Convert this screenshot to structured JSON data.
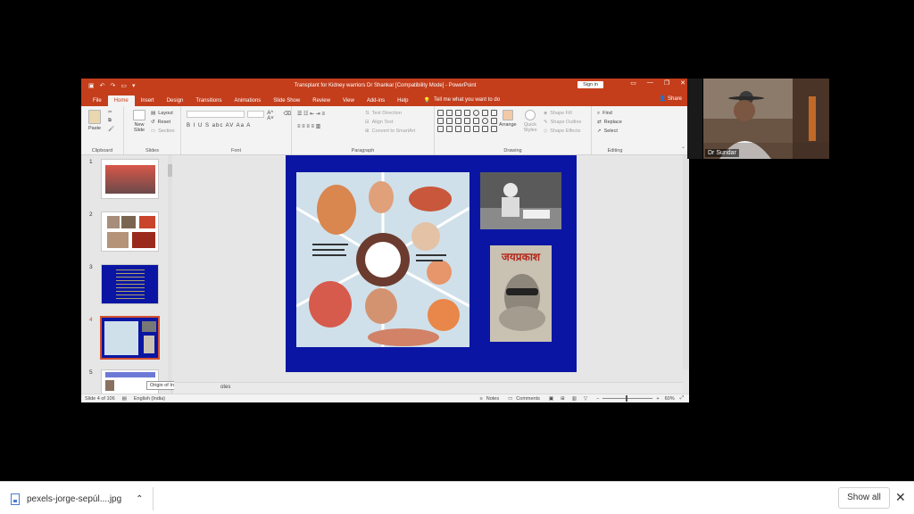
{
  "ppt": {
    "title": "Transplant for Kidney warriors  Dr Shankar [Compatibility Mode]  -  PowerPoint",
    "sign_in": "Sign in",
    "window_controls": [
      "▭",
      "—",
      "❐",
      "✕"
    ],
    "tabs": [
      "File",
      "Home",
      "Insert",
      "Design",
      "Transitions",
      "Animations",
      "Slide Show",
      "Review",
      "View",
      "Add-ins",
      "Help"
    ],
    "active_tab": "Home",
    "tell_me": "Tell me what you want to do",
    "share": "Share",
    "ribbon": {
      "clipboard": {
        "paste": "Paste",
        "label": "Clipboard"
      },
      "slides": {
        "new_slide": "New Slide",
        "layout": "Layout",
        "reset": "Reset",
        "section": "Section",
        "label": "Slides"
      },
      "font": {
        "label": "Font",
        "buttons": "B  I  U  S  abc  AV  Aa  A"
      },
      "paragraph": {
        "text_direction": "Text Direction",
        "align_text": "Align Text",
        "smartart": "Convert to SmartArt",
        "label": "Paragraph"
      },
      "drawing": {
        "arrange": "Arrange",
        "quick_styles": "Quick Styles",
        "shape_fill": "Shape Fill",
        "shape_outline": "Shape Outline",
        "shape_effects": "Shape Effects",
        "label": "Drawing"
      },
      "editing": {
        "find": "Find",
        "replace": "Replace",
        "select": "Select",
        "label": "Editing"
      }
    },
    "thumbnails": [
      "1",
      "2",
      "3",
      "4",
      "5"
    ],
    "selected_slide": "4",
    "tooltip": "Origin of Interventional Nephr...",
    "notes_hint": "otes",
    "book_title": "जयप्रकाश",
    "status": {
      "slide": "Slide 4 of 106",
      "language": "English (India)",
      "notes": "Notes",
      "comments": "Comments",
      "zoom": "60%"
    }
  },
  "video": {
    "participant": "Dr Sundar"
  },
  "downloads": {
    "file_name": "pexels-jorge-sepúl....jpg",
    "show_all": "Show all"
  },
  "colors": {
    "ppt_accent": "#c43e1c",
    "slide_bg": "#0a16a3"
  }
}
